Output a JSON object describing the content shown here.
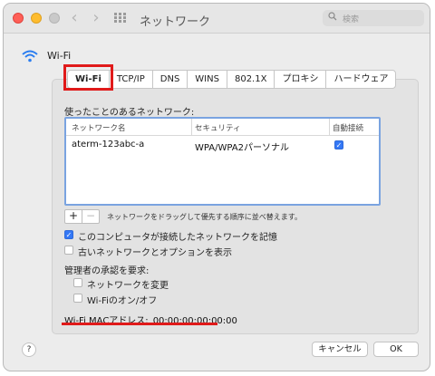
{
  "window": {
    "title": "ネットワーク"
  },
  "toolbar": {
    "back": "‹",
    "forward": "›"
  },
  "search": {
    "placeholder": "検索"
  },
  "header": {
    "service": "Wi-Fi"
  },
  "tabs": [
    "Wi-Fi",
    "TCP/IP",
    "DNS",
    "WINS",
    "802.1X",
    "プロキシ",
    "ハードウェア"
  ],
  "known_networks": {
    "label": "使ったことのあるネットワーク:",
    "columns": {
      "name": "ネットワーク名",
      "security": "セキュリティ",
      "auto_join": "自動接続"
    },
    "rows": [
      {
        "name": "aterm-123abc-a",
        "security": "WPA/WPA2パーソナル",
        "auto_join": true
      }
    ]
  },
  "list_controls": {
    "add": "+",
    "remove": "−",
    "hint": "ネットワークをドラッグして優先する順序に並べ替えます。"
  },
  "options": {
    "remember_networks": {
      "label": "このコンピュータが接続したネットワークを記憶",
      "checked": true
    },
    "show_legacy": {
      "label": "古いネットワークとオプションを表示",
      "checked": false
    }
  },
  "admin": {
    "label": "管理者の承認を要求:",
    "change_networks": {
      "label": "ネットワークを変更",
      "checked": false
    },
    "toggle_wifi": {
      "label": "Wi-Fiのオン/オフ",
      "checked": false
    }
  },
  "mac": {
    "label": "Wi-Fi MACアドレス:",
    "value": "00:00:00:00:00:00"
  },
  "buttons": {
    "help": "?",
    "cancel": "キャンセル",
    "ok": "OK"
  },
  "colors": {
    "accent": "#3478f6",
    "highlight": "#e01a1a"
  }
}
